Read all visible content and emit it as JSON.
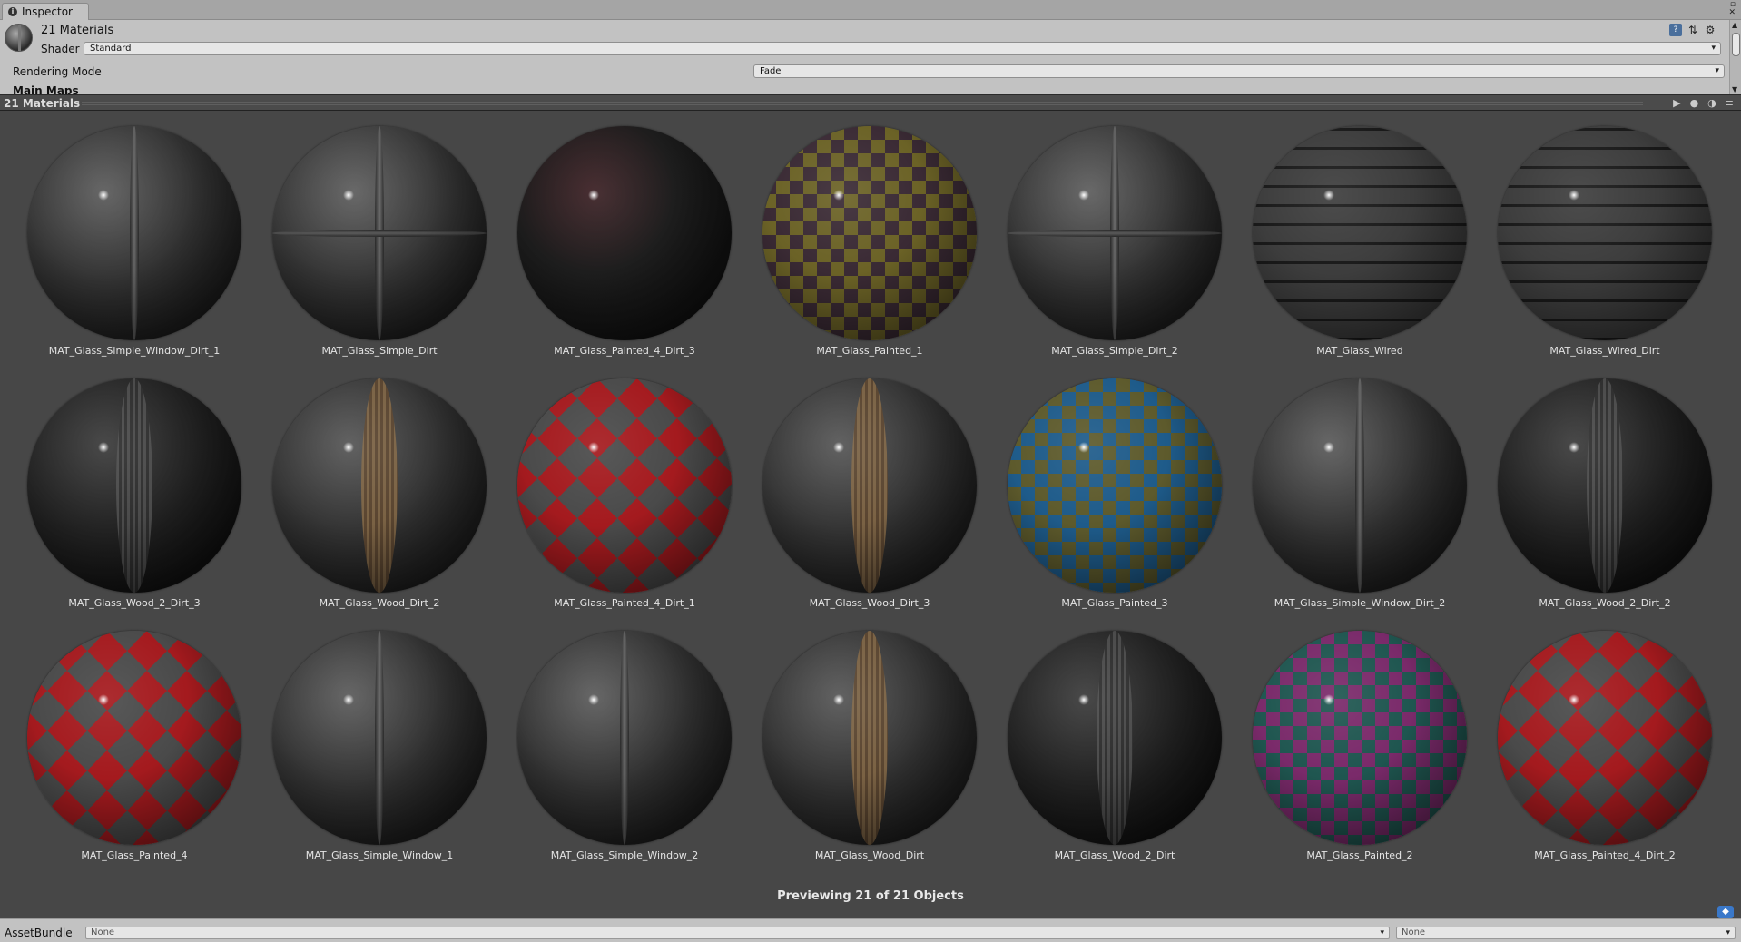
{
  "tab": {
    "title": "Inspector",
    "icon": "info-icon"
  },
  "header": {
    "title": "21 Materials",
    "shader_label": "Shader",
    "shader_value": "Standard"
  },
  "rendering_mode": {
    "label": "Rendering Mode",
    "value": "Fade"
  },
  "section": {
    "main_maps": "Main Maps"
  },
  "preview": {
    "title": "21 Materials",
    "footer": "Previewing 21 of 21 Objects",
    "materials": [
      {
        "name": "MAT_Glass_Simple_Window_Dirt_1",
        "style": "window"
      },
      {
        "name": "MAT_Glass_Simple_Dirt",
        "style": "cross"
      },
      {
        "name": "MAT_Glass_Painted_4_Dirt_3",
        "style": "darkpaint"
      },
      {
        "name": "MAT_Glass_Painted_1",
        "style": "checker-yellow"
      },
      {
        "name": "MAT_Glass_Simple_Dirt_2",
        "style": "cross"
      },
      {
        "name": "MAT_Glass_Wired",
        "style": "wired"
      },
      {
        "name": "MAT_Glass_Wired_Dirt",
        "style": "wired"
      },
      {
        "name": "MAT_Glass_Wood_2_Dirt_3",
        "style": "wood-dark"
      },
      {
        "name": "MAT_Glass_Wood_Dirt_2",
        "style": "wood"
      },
      {
        "name": "MAT_Glass_Painted_4_Dirt_1",
        "style": "red-pattern"
      },
      {
        "name": "MAT_Glass_Wood_Dirt_3",
        "style": "wood"
      },
      {
        "name": "MAT_Glass_Painted_3",
        "style": "checker-blue"
      },
      {
        "name": "MAT_Glass_Simple_Window_Dirt_2",
        "style": "window"
      },
      {
        "name": "MAT_Glass_Wood_2_Dirt_2",
        "style": "wood-dark"
      },
      {
        "name": "MAT_Glass_Painted_4",
        "style": "red-pattern"
      },
      {
        "name": "MAT_Glass_Simple_Window_1",
        "style": "window"
      },
      {
        "name": "MAT_Glass_Simple_Window_2",
        "style": "window"
      },
      {
        "name": "MAT_Glass_Wood_Dirt",
        "style": "wood"
      },
      {
        "name": "MAT_Glass_Wood_2_Dirt",
        "style": "wood-dark"
      },
      {
        "name": "MAT_Glass_Painted_2",
        "style": "checker-pink"
      },
      {
        "name": "MAT_Glass_Painted_4_Dirt_2",
        "style": "red-pattern"
      }
    ]
  },
  "asset_bundle": {
    "label": "AssetBundle",
    "value": "None",
    "variant": "None"
  },
  "colors": {
    "panel": "#c2c2c2",
    "preview_bg": "#474747",
    "preview_bar": "#4b4b4b"
  }
}
